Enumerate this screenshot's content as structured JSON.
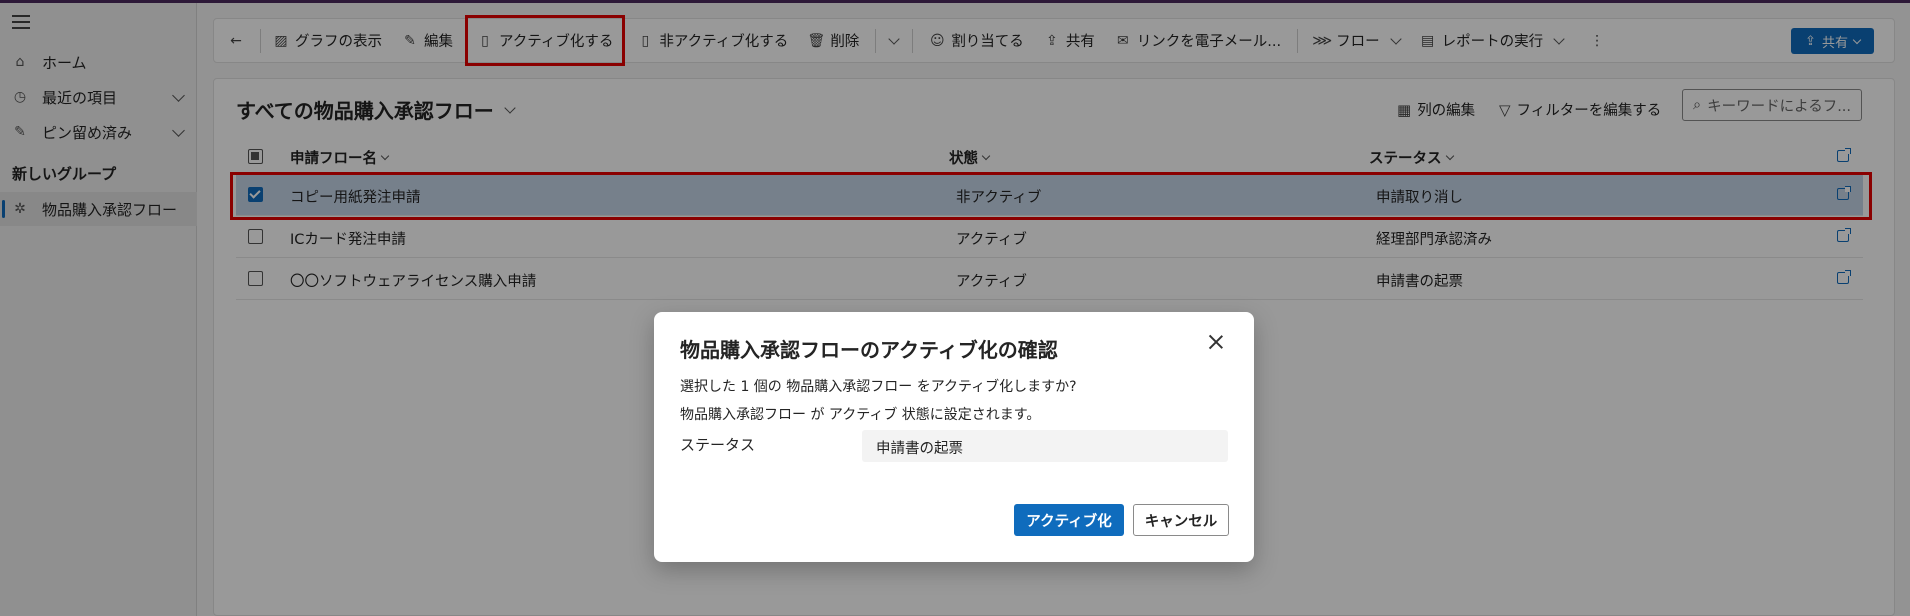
{
  "sidebar": {
    "home_label": "ホーム",
    "recent_label": "最近の項目",
    "pinned_label": "ピン留め済み",
    "group_label": "新しいグループ",
    "active_item_label": "物品購入承認フロー"
  },
  "toolbar": {
    "show_chart": "グラフの表示",
    "edit": "編集",
    "activate": "アクティブ化する",
    "deactivate": "非アクティブ化する",
    "delete": "削除",
    "assign": "割り当てる",
    "share": "共有",
    "email_link": "リンクを電子メール...",
    "flow": "フロー",
    "run_report": "レポートの実行",
    "share_button": "共有"
  },
  "view": {
    "title": "すべての物品購入承認フロー",
    "edit_columns": "列の編集",
    "edit_filters": "フィルターを編集する",
    "search_placeholder": "キーワードによるフ..."
  },
  "grid": {
    "columns": [
      "申請フロー名",
      "状態",
      "ステータス"
    ],
    "rows": [
      {
        "name": "コピー用紙発注申請",
        "state": "非アクティブ",
        "status": "申請取り消し",
        "selected": true
      },
      {
        "name": "ICカード発注申請",
        "state": "アクティブ",
        "status": "経理部門承認済み",
        "selected": false
      },
      {
        "name": "〇〇ソフトウェアライセンス購入申請",
        "state": "アクティブ",
        "status": "申請書の起票",
        "selected": false
      }
    ]
  },
  "dialog": {
    "title": "物品購入承認フローのアクティブ化の確認",
    "line1": "選択した 1 個の 物品購入承認フロー をアクティブ化しますか?",
    "line2": "物品購入承認フロー が アクティブ 状態に設定されます。",
    "field_label": "ステータス",
    "field_value": "申請書の起票",
    "confirm": "アクティブ化",
    "cancel": "キャンセル"
  },
  "colors": {
    "accent": "#0f6cbd",
    "highlight": "#e60000",
    "selected_row": "#c5d5e8"
  }
}
